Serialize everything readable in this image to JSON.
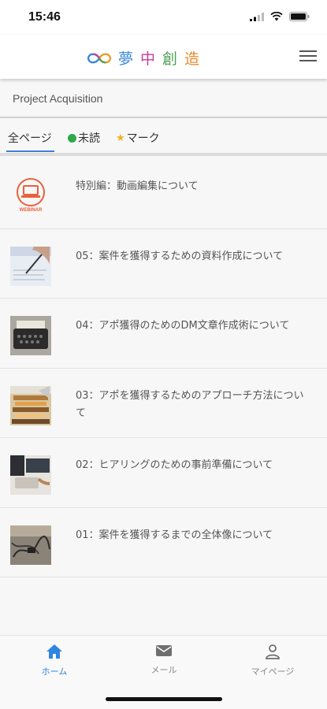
{
  "status_bar": {
    "time": "15:46"
  },
  "header": {
    "logo_chars": [
      "夢",
      "中",
      "創",
      "造"
    ],
    "logo_colors": [
      "#3a87d9",
      "#c93c9a",
      "#4a9e4f",
      "#e58a2b"
    ]
  },
  "page": {
    "title": "Project Acquisition"
  },
  "filters": {
    "all": "全ページ",
    "unread": "未読",
    "mark": "マーク"
  },
  "webinar_badge": "WEBINAR",
  "items": [
    {
      "title": "特別編：動画編集について",
      "thumb": "webinar-icon"
    },
    {
      "title": "05：案件を獲得するための資料作成について",
      "thumb": "writing-photo"
    },
    {
      "title": "04：アポ獲得のためのDM文章作成術について",
      "thumb": "typewriter-photo"
    },
    {
      "title": "03：アポを獲得するためのアプローチ方法について",
      "thumb": "books-photo"
    },
    {
      "title": "02：ヒアリングのための事前準備について",
      "thumb": "desk-photo"
    },
    {
      "title": "01：案件を獲得するまでの全体像について",
      "thumb": "cables-photo"
    }
  ],
  "bottom_nav": {
    "home": "ホーム",
    "mail": "メール",
    "mypage": "マイページ",
    "active_color": "#2f86e0"
  }
}
